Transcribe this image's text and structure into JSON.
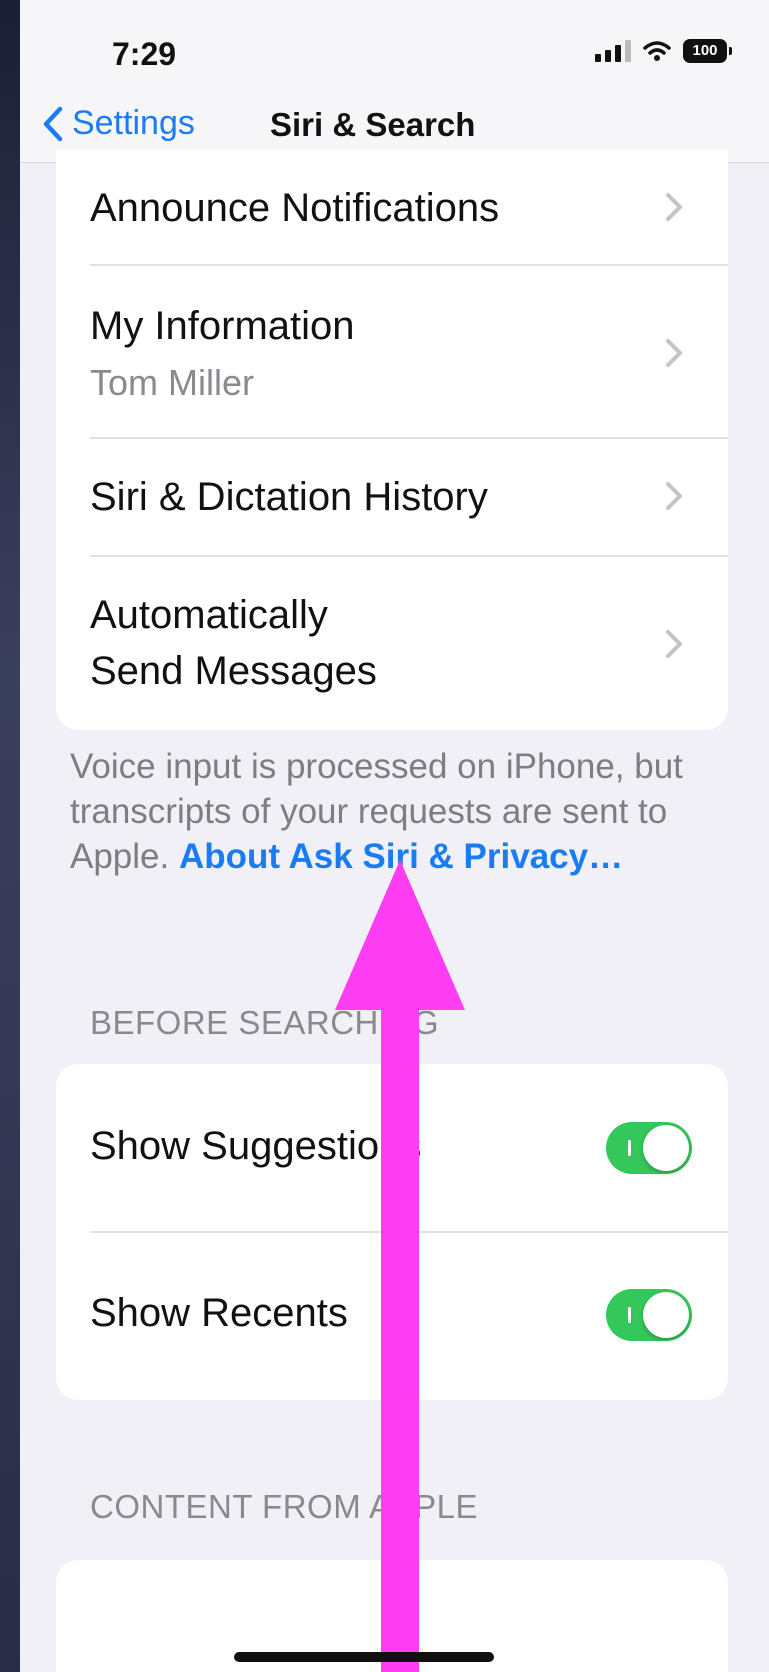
{
  "status_bar": {
    "time": "7:29",
    "battery": "100"
  },
  "nav": {
    "back_label": "Settings",
    "title": "Siri & Search"
  },
  "siri_rows": [
    {
      "label": "Announce Notifications"
    },
    {
      "label": "My Information",
      "sublabel": "Tom Miller"
    },
    {
      "label": "Siri & Dictation History"
    },
    {
      "label_line1": "Automatically",
      "label_line2": "Send Messages"
    }
  ],
  "privacy_footer": {
    "text": "Voice input is processed on iPhone, but transcripts of your requests are sent to Apple.",
    "link": "About Ask Siri & Privacy…"
  },
  "before_searching": {
    "header": "BEFORE SEARCHING",
    "rows": [
      {
        "label": "Show Suggestions",
        "on": true
      },
      {
        "label": "Show Recents",
        "on": true
      }
    ]
  },
  "content_from_apple": {
    "header": "CONTENT FROM APPLE"
  },
  "colors": {
    "accent": "#1a7cf5",
    "toggle_on": "#34c759",
    "annotation_arrow": "#ff3df2"
  },
  "icons": [
    "chevron-left-icon",
    "chevron-right-icon",
    "cellular-signal-icon",
    "wifi-icon",
    "battery-icon"
  ]
}
